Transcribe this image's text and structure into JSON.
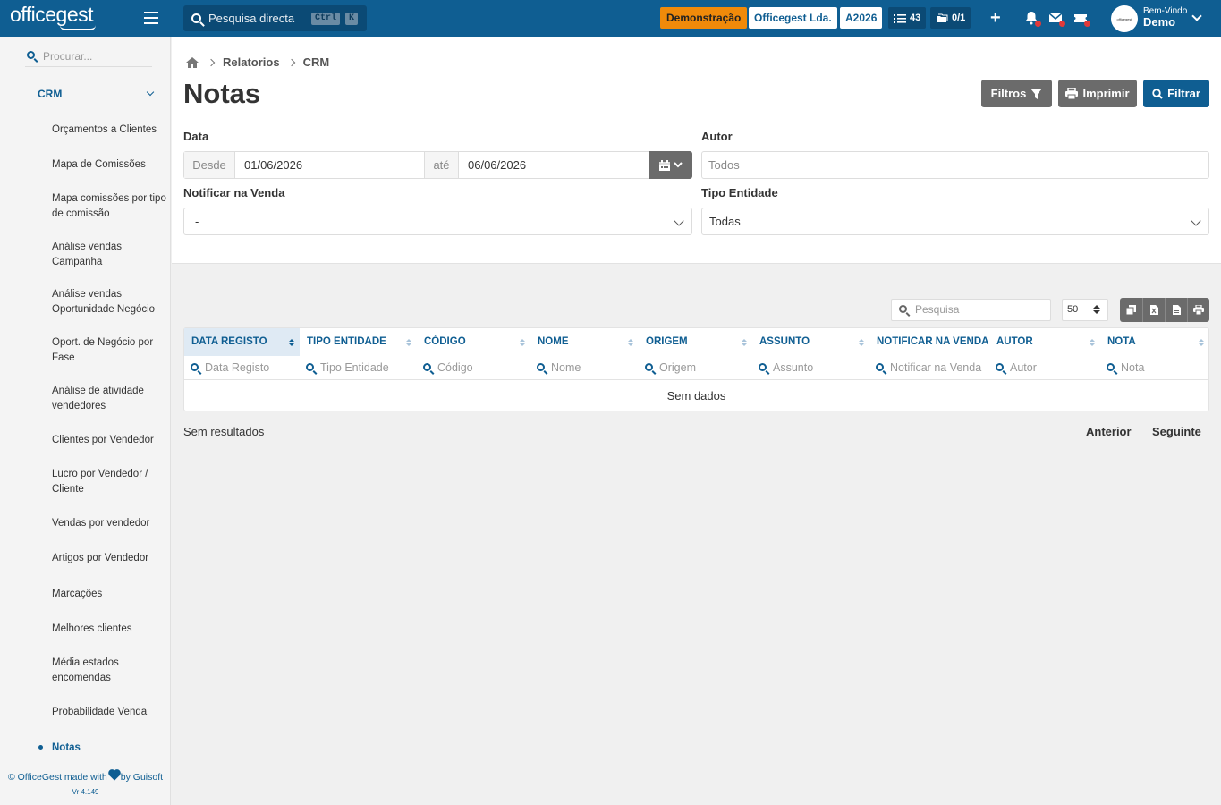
{
  "topbar": {
    "logo": "officegest",
    "search_placeholder": "Pesquisa directa",
    "kbd_ctrl": "Ctrl",
    "kbd_k": "K",
    "badge_demo": "Demonstração",
    "badge_company": "Officegest Lda.",
    "badge_year": "A2026",
    "tasks_count": "43",
    "docs_count": "0/1",
    "plus": "+",
    "avatar_text": "officegest",
    "welcome": "Bem-Vindo",
    "user": "Demo"
  },
  "sidebar": {
    "search_placeholder": "Procurar...",
    "section": "CRM",
    "items": [
      "Orçamentos a Clientes",
      "Mapa de Comissões",
      "Mapa comissões por tipo de comissão",
      "Análise vendas Campanha",
      "Análise vendas Oportunidade Negócio",
      "Oport. de Negócio por Fase",
      "Análise de atividade vendedores",
      "Clientes por Vendedor",
      "Lucro por Vendedor / Cliente",
      "Vendas por vendedor",
      "Artigos por Vendedor",
      "Marcações",
      "Melhores clientes",
      "Média estados encomendas",
      "Probabilidade Venda",
      "Notas"
    ],
    "footer_a": "© OfficeGest made with",
    "footer_b": "by Guisoft",
    "version": "Vr 4.149"
  },
  "breadcrumb": {
    "level1": "Relatorios",
    "level2": "CRM"
  },
  "page": {
    "title": "Notas"
  },
  "actions": {
    "filtros": "Filtros",
    "imprimir": "Imprimir",
    "filtrar": "Filtrar"
  },
  "filters": {
    "data_label": "Data",
    "desde_label": "Desde",
    "desde_value": "01/06/2026",
    "ate_label": "até",
    "ate_value": "06/06/2026",
    "autor_label": "Autor",
    "autor_placeholder": "Todos",
    "notificar_label": "Notificar na Venda",
    "notificar_value": "-",
    "tipo_label": "Tipo Entidade",
    "tipo_value": "Todas"
  },
  "table": {
    "search_placeholder": "Pesquisa",
    "page_size": "50",
    "columns": [
      {
        "header": "DATA REGISTO",
        "filter": "Data Registo"
      },
      {
        "header": "TIPO ENTIDADE",
        "filter": "Tipo Entidade"
      },
      {
        "header": "CÓDIGO",
        "filter": "Código"
      },
      {
        "header": "NOME",
        "filter": "Nome"
      },
      {
        "header": "ORIGEM",
        "filter": "Origem"
      },
      {
        "header": "ASSUNTO",
        "filter": "Assunto"
      },
      {
        "header": "NOTIFICAR NA VENDA",
        "filter": "Notificar na Venda"
      },
      {
        "header": "AUTOR",
        "filter": "Autor"
      },
      {
        "header": "NOTA",
        "filter": "Nota"
      }
    ],
    "empty": "Sem dados",
    "results": "Sem resultados",
    "prev": "Anterior",
    "next": "Seguinte"
  },
  "colors": {
    "brand": "#0f5e92",
    "demo": "#f08a0a",
    "grey_button": "#6b6b6b"
  }
}
